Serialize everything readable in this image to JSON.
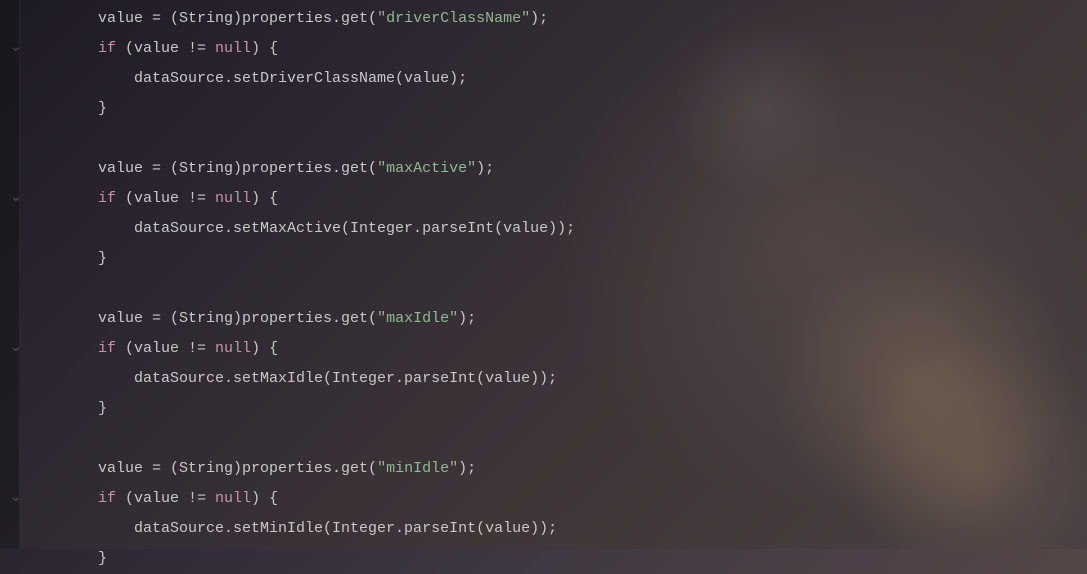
{
  "code": {
    "lines": [
      {
        "indent": 0,
        "tokens": [
          {
            "t": "value = (",
            "c": "plain"
          },
          {
            "t": "String",
            "c": "plain"
          },
          {
            "t": ")properties.get(",
            "c": "plain"
          },
          {
            "t": "\"driverClassName\"",
            "c": "string"
          },
          {
            "t": ");",
            "c": "plain"
          }
        ]
      },
      {
        "indent": 0,
        "tokens": [
          {
            "t": "if",
            "c": "keyword"
          },
          {
            "t": " (value != ",
            "c": "plain"
          },
          {
            "t": "null",
            "c": "keyword-null"
          },
          {
            "t": ") {",
            "c": "plain"
          }
        ]
      },
      {
        "indent": 1,
        "tokens": [
          {
            "t": "dataSource.setDriverClassName(value);",
            "c": "plain"
          }
        ]
      },
      {
        "indent": 0,
        "tokens": [
          {
            "t": "}",
            "c": "brace"
          }
        ]
      },
      {
        "indent": 0,
        "tokens": []
      },
      {
        "indent": 0,
        "tokens": [
          {
            "t": "value = (",
            "c": "plain"
          },
          {
            "t": "String",
            "c": "plain"
          },
          {
            "t": ")properties.get(",
            "c": "plain"
          },
          {
            "t": "\"maxActive\"",
            "c": "string"
          },
          {
            "t": ");",
            "c": "plain"
          }
        ]
      },
      {
        "indent": 0,
        "tokens": [
          {
            "t": "if",
            "c": "keyword"
          },
          {
            "t": " (value != ",
            "c": "plain"
          },
          {
            "t": "null",
            "c": "keyword-null"
          },
          {
            "t": ") {",
            "c": "plain"
          }
        ]
      },
      {
        "indent": 1,
        "tokens": [
          {
            "t": "dataSource.setMaxActive(Integer.parseInt(value));",
            "c": "plain"
          }
        ]
      },
      {
        "indent": 0,
        "tokens": [
          {
            "t": "}",
            "c": "brace"
          }
        ]
      },
      {
        "indent": 0,
        "tokens": []
      },
      {
        "indent": 0,
        "tokens": [
          {
            "t": "value = (",
            "c": "plain"
          },
          {
            "t": "String",
            "c": "plain"
          },
          {
            "t": ")properties.get(",
            "c": "plain"
          },
          {
            "t": "\"maxIdle\"",
            "c": "string"
          },
          {
            "t": ");",
            "c": "plain"
          }
        ]
      },
      {
        "indent": 0,
        "tokens": [
          {
            "t": "if",
            "c": "keyword"
          },
          {
            "t": " (value != ",
            "c": "plain"
          },
          {
            "t": "null",
            "c": "keyword-null"
          },
          {
            "t": ") {",
            "c": "plain"
          }
        ]
      },
      {
        "indent": 1,
        "tokens": [
          {
            "t": "dataSource.setMaxIdle(Integer.parseInt(value));",
            "c": "plain"
          }
        ]
      },
      {
        "indent": 0,
        "tokens": [
          {
            "t": "}",
            "c": "brace"
          }
        ]
      },
      {
        "indent": 0,
        "tokens": []
      },
      {
        "indent": 0,
        "tokens": [
          {
            "t": "value = (",
            "c": "plain"
          },
          {
            "t": "String",
            "c": "plain"
          },
          {
            "t": ")properties.get(",
            "c": "plain"
          },
          {
            "t": "\"minIdle\"",
            "c": "string"
          },
          {
            "t": ");",
            "c": "plain"
          }
        ]
      },
      {
        "indent": 0,
        "tokens": [
          {
            "t": "if",
            "c": "keyword"
          },
          {
            "t": " (value != ",
            "c": "plain"
          },
          {
            "t": "null",
            "c": "keyword-null"
          },
          {
            "t": ") {",
            "c": "plain"
          }
        ]
      },
      {
        "indent": 1,
        "tokens": [
          {
            "t": "dataSource.setMinIdle(Integer.parseInt(value));",
            "c": "plain"
          }
        ]
      },
      {
        "indent": 0,
        "tokens": [
          {
            "t": "}",
            "c": "brace"
          }
        ]
      }
    ]
  },
  "fold_positions": [
    34,
    184,
    334,
    484
  ],
  "fold_glyph": "⌄"
}
